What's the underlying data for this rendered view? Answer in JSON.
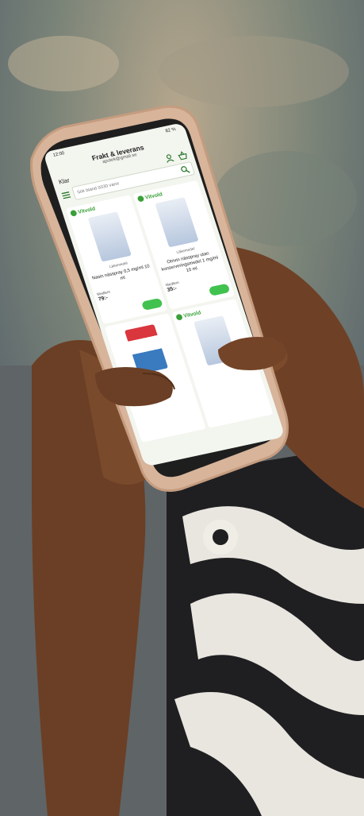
{
  "status": {
    "time": "12:00",
    "battery": "82 %"
  },
  "header": {
    "close_label": "Klar",
    "store_title": "Frakt & leverans",
    "store_email": "apotek@gmail.se"
  },
  "search": {
    "placeholder": "Sök bland 9330 varor"
  },
  "products": [
    {
      "brand": "Vitvold",
      "rx": "Läkemedel",
      "name": "Nasin nässpray 0,5 mg/ml 10 ml",
      "from": "Medlem",
      "price": "79:-"
    },
    {
      "brand": "Vitvold",
      "rx": "Läkemedel",
      "name": "Otrivin nässpray utan konserveringsmedel 1 mg/ml 10 ml",
      "from": "Medlem",
      "price": "35:-"
    },
    {
      "brand": "",
      "rx": "",
      "name": "",
      "from": "",
      "price": ""
    },
    {
      "brand": "Vitvold",
      "rx": "",
      "name": "",
      "from": "",
      "price": ""
    }
  ],
  "colors": {
    "accent": "#41c24f",
    "brand": "#3aa03a"
  }
}
